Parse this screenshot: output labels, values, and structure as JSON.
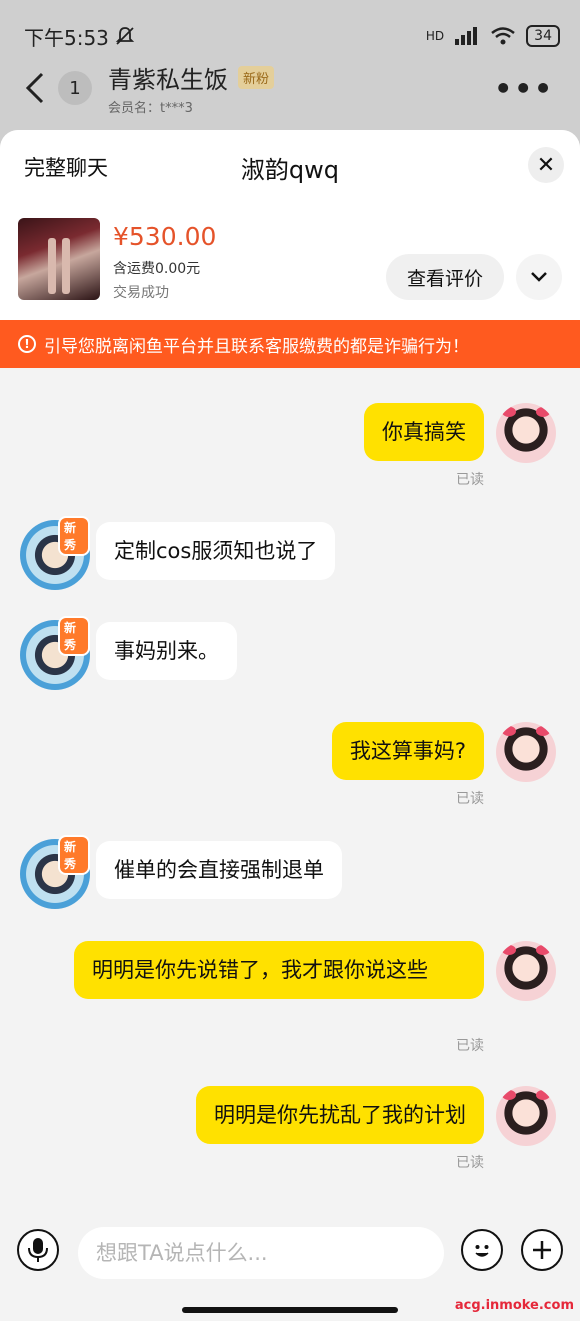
{
  "status_bar": {
    "time": "下午5:53",
    "network": "HD",
    "battery": "34"
  },
  "background_header": {
    "unread_count": "1",
    "seller_name": "青紫私生饭",
    "new_fan_tag": "新粉",
    "member_name": "会员名：t***3"
  },
  "sheet": {
    "full_chat_label": "完整聊天",
    "title": "淑韵qwq",
    "close_label": "✕"
  },
  "order": {
    "price": "¥530.00",
    "shipping": "含运费0.00元",
    "status": "交易成功",
    "review_button": "查看评价"
  },
  "warning": {
    "icon": "!",
    "text": "引导您脱离闲鱼平台并且联系客服缴费的都是诈骗行为！"
  },
  "messages": [
    {
      "side": "mine",
      "text": "你真搞笑",
      "read": "已读"
    },
    {
      "side": "theirs",
      "text": "定制cos服须知也说了"
    },
    {
      "side": "theirs",
      "text": "事妈别来。"
    },
    {
      "side": "mine",
      "text": "我这算事妈?",
      "read": "已读"
    },
    {
      "side": "theirs",
      "text": "催单的会直接强制退单"
    },
    {
      "side": "mine",
      "text": "明明是你先说错了，我才跟你说这些",
      "read": "已读"
    },
    {
      "side": "mine",
      "text": "明明是你先扰乱了我的计划",
      "read": "已读"
    }
  ],
  "avatar_badge": "新秀",
  "input": {
    "placeholder": "想跟TA说点什么..."
  },
  "watermark": "acg.inmoke.com",
  "icons": {
    "voice": "microphone-icon",
    "emoji": "smiley-icon",
    "more": "plus-icon"
  }
}
